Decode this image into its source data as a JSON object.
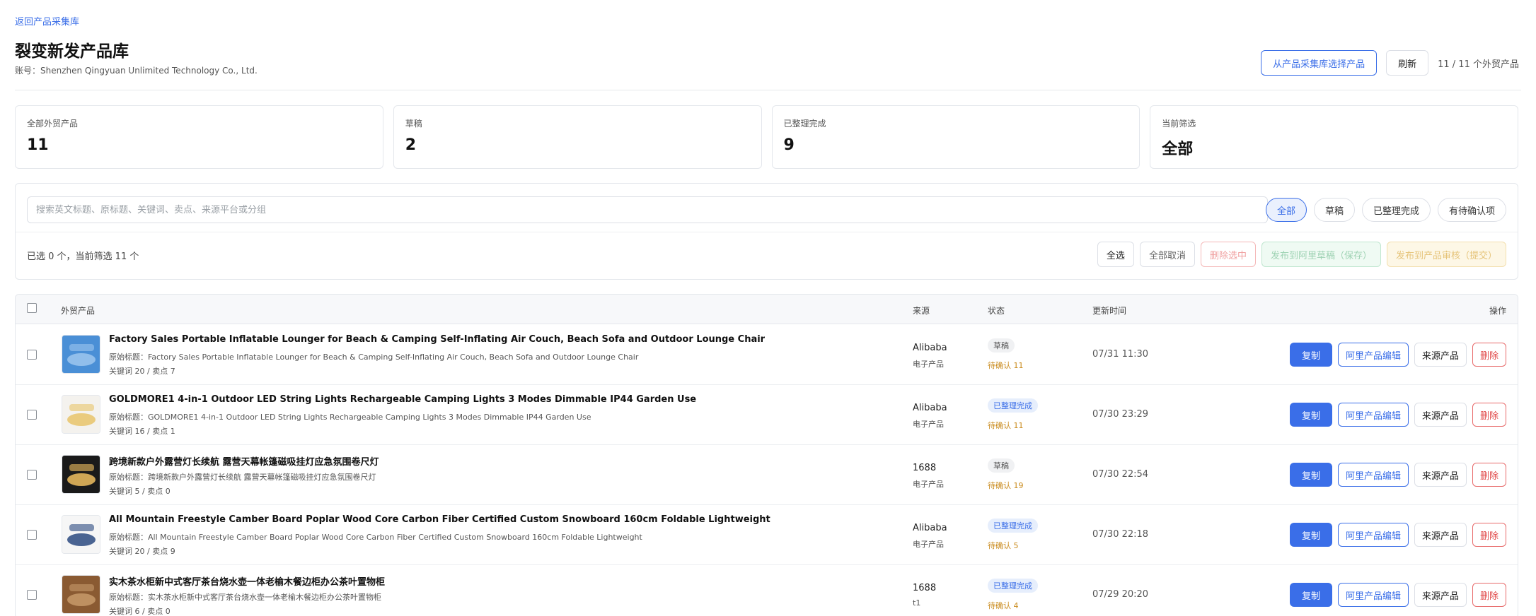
{
  "back_link": "返回产品采集库",
  "page_title": "裂变新发产品库",
  "account": {
    "label": "账号：",
    "name": "Shenzhen Qingyuan Unlimited Technology Co., Ltd."
  },
  "header": {
    "select_button": "从产品采集库选择产品",
    "refresh_button": "刷新",
    "count_text": "11 / 11 个外贸产品"
  },
  "stats": [
    {
      "label": "全部外贸产品",
      "value": "11"
    },
    {
      "label": "草稿",
      "value": "2"
    },
    {
      "label": "已整理完成",
      "value": "9"
    },
    {
      "label": "当前筛选",
      "value": "全部"
    }
  ],
  "search": {
    "placeholder": "搜索英文标题、原标题、关键词、卖点、来源平台或分组",
    "value": ""
  },
  "filter_chips": [
    {
      "label": "全部",
      "active": true
    },
    {
      "label": "草稿",
      "active": false
    },
    {
      "label": "已整理完成",
      "active": false
    },
    {
      "label": "有待确认项",
      "active": false
    }
  ],
  "selection_info": "已选 0 个，当前筛选 11 个",
  "bulk_actions": {
    "select_all": "全选",
    "deselect_all": "全部取消",
    "delete_selected": "删除选中",
    "publish_ali_draft": "发布到阿里草稿（保存）",
    "publish_review": "发布到产品审核（提交）"
  },
  "table": {
    "headers": {
      "product": "外贸产品",
      "source": "来源",
      "status": "状态",
      "updated": "更新时间",
      "actions": "操作"
    },
    "row_actions": {
      "copy": "复制",
      "edit": "阿里产品编辑",
      "source": "来源产品",
      "delete": "删除"
    },
    "rows": [
      {
        "title": "Factory Sales Portable Inflatable Lounger for Beach & Camping Self-Inflating Air Couch, Beach Sofa and Outdoor Lounge Chair",
        "original": "原始标题：Factory Sales Portable Inflatable Lounger for Beach & Camping Self-Inflating Air Couch, Beach Sofa and Outdoor Lounge Chair",
        "meta": "关键词 20 / 卖点 7",
        "source": "Alibaba",
        "category": "电子产品",
        "status": "草稿",
        "status_type": "draft",
        "pending": "待确认 11",
        "updated": "07/31 11:30",
        "thumb_color": "#4a8fd6",
        "thumb_accent": "#9ec7ee"
      },
      {
        "title": "GOLDMORE1 4-in-1 Outdoor LED String Lights Rechargeable Camping Lights 3 Modes Dimmable IP44 Garden Use",
        "original": "原始标题：GOLDMORE1 4-in-1 Outdoor LED String Lights Rechargeable Camping Lights 3 Modes Dimmable IP44 Garden Use",
        "meta": "关键词 16 / 卖点 1",
        "source": "Alibaba",
        "category": "电子产品",
        "status": "已整理完成",
        "status_type": "done",
        "pending": "待确认 11",
        "updated": "07/30 23:29",
        "thumb_color": "#f4f2ee",
        "thumb_accent": "#e8c46a"
      },
      {
        "title": "跨境新款户外露营灯长续航 露营天幕帐篷磁吸挂灯应急氛围卷尺灯",
        "original": "原始标题：跨境新款户外露营灯长续航 露营天幕帐篷磁吸挂灯应急氛围卷尺灯",
        "meta": "关键词 5 / 卖点 0",
        "source": "1688",
        "category": "电子产品",
        "status": "草稿",
        "status_type": "draft",
        "pending": "待确认 19",
        "updated": "07/30 22:54",
        "thumb_color": "#1a1a1a",
        "thumb_accent": "#f0c060"
      },
      {
        "title": "All Mountain Freestyle Camber Board Poplar Wood Core Carbon Fiber Certified Custom Snowboard 160cm Foldable Lightweight",
        "original": "原始标题：All Mountain Freestyle Camber Board Poplar Wood Core Carbon Fiber Certified Custom Snowboard 160cm Foldable Lightweight",
        "meta": "关键词 20 / 卖点 9",
        "source": "Alibaba",
        "category": "电子产品",
        "status": "已整理完成",
        "status_type": "done",
        "pending": "待确认 5",
        "updated": "07/30 22:18",
        "thumb_color": "#f6f6f6",
        "thumb_accent": "#2b4a80"
      },
      {
        "title": "实木茶水柜新中式客厅茶台烧水壶一体老榆木餐边柜办公茶叶置物柜",
        "original": "原始标题：实木茶水柜新中式客厅茶台烧水壶一体老榆木餐边柜办公茶叶置物柜",
        "meta": "关键词 6 / 卖点 0",
        "source": "1688",
        "category": "t1",
        "status": "已整理完成",
        "status_type": "done",
        "pending": "待确认 4",
        "updated": "07/29 20:20",
        "thumb_color": "#8a5a32",
        "thumb_accent": "#c79a6a"
      }
    ]
  }
}
